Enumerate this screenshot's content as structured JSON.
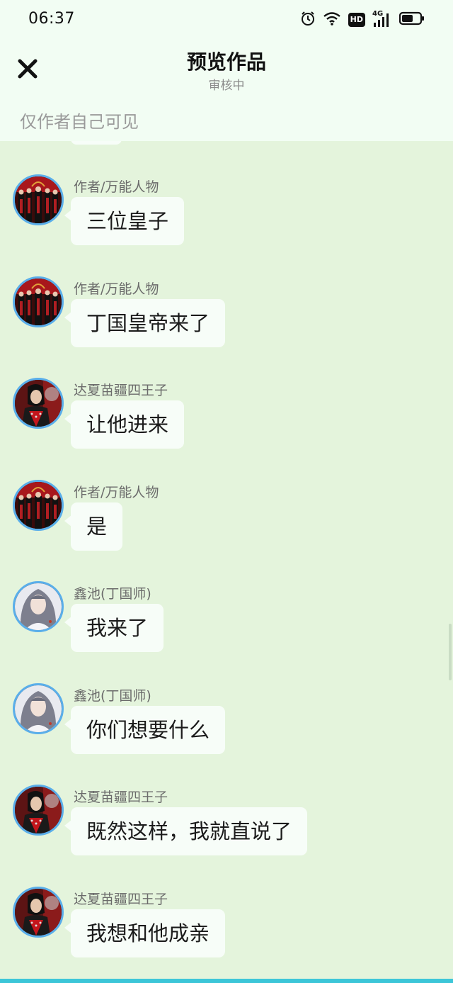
{
  "status_bar": {
    "time": "06:37",
    "icons": [
      "alarm-icon",
      "wifi-icon",
      "hd-icon",
      "signal-4g-icon",
      "battery-icon"
    ],
    "hd_label": "HD",
    "network_label": "4G"
  },
  "header": {
    "close_icon": "close-icon",
    "title": "预览作品",
    "subtitle": "审核中",
    "visibility_note": "仅作者自己可见"
  },
  "messages": [
    {
      "sender": "作者/万能人物",
      "text": "三位皇子",
      "avatar": "group-avatar"
    },
    {
      "sender": "作者/万能人物",
      "text": "丁国皇帝来了",
      "avatar": "group-avatar"
    },
    {
      "sender": "达夏苗疆四王子",
      "text": "让他进来",
      "avatar": "prince-avatar"
    },
    {
      "sender": "作者/万能人物",
      "text": "是",
      "avatar": "group-avatar"
    },
    {
      "sender": "鑫池(丁国师)",
      "text": "我来了",
      "avatar": "mentor-avatar"
    },
    {
      "sender": "鑫池(丁国师)",
      "text": "你们想要什么",
      "avatar": "mentor-avatar"
    },
    {
      "sender": "达夏苗疆四王子",
      "text": "既然这样，我就直说了",
      "avatar": "prince-avatar"
    },
    {
      "sender": "达夏苗疆四王子",
      "text": "我想和他成亲",
      "avatar": "prince-avatar"
    }
  ],
  "colors": {
    "header_bg": "#f2fdf3",
    "chat_bg": "#e4f4dc",
    "bubble_bg": "#f7fdf8",
    "avatar_ring": "#5aaeea",
    "bottom_bar": "#3cc6d8"
  }
}
